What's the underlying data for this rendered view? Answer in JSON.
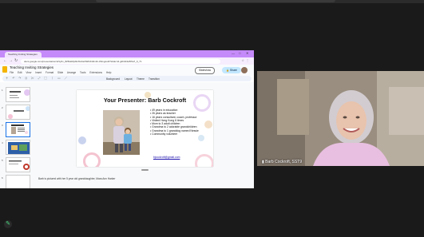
{
  "browser": {
    "tab_title": "Teaching Inviting Strategies",
    "url": "docs.google.com/presentation/d/1y0x_8Z8xkMjd3cXfe6eNWbtK3dx1b-Wkvg/edit?slide=id.g2b3d4e5f6a7_0_71",
    "window_controls": [
      "—",
      "□",
      "✕"
    ]
  },
  "docs": {
    "title": "Teaching Inviting Strategies",
    "menus": [
      "File",
      "Edit",
      "View",
      "Insert",
      "Format",
      "Slide",
      "Arrange",
      "Tools",
      "Extensions",
      "Help"
    ],
    "toolbar_labels": [
      "Background",
      "Layout",
      "Theme",
      "Transition"
    ],
    "slideshow_label": "Slideshow",
    "share_label": "Share",
    "accent_color": "#c58af9"
  },
  "filmstrip": {
    "numbers": [
      "1",
      "2",
      "3",
      "4",
      "5",
      "6"
    ]
  },
  "slide": {
    "title": "Your Presenter: Barb Cockroft",
    "bullets": [
      "49 years in education",
      "26 years as teacher",
      "16 years consultant, coach, professor",
      "Visited Hong Kong 6 times",
      "Mom to 3 adult children",
      "Grandma to 2 adorable grandchildren",
      "Grandma to 1 granddog named Nessie",
      "Community volunteer"
    ],
    "email": "bjcockroft@gmail.com"
  },
  "speaker_notes": "Barb is pictured with her 5 year old granddaughter, Mara Ann Harker",
  "video": {
    "participant_name": "Barb Cockroft, SST9"
  }
}
